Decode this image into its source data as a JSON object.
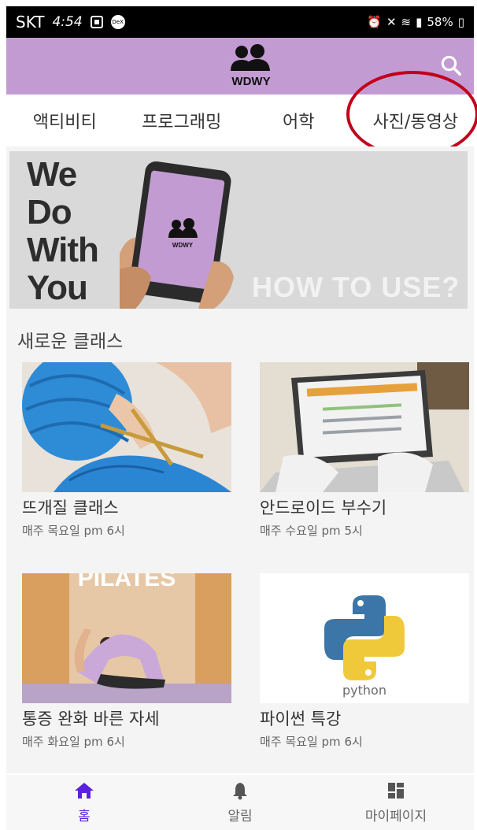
{
  "status_bar": {
    "carrier": "SKT",
    "time": "4:54",
    "battery": "58%"
  },
  "app": {
    "logo_text": "WDWY",
    "brand_color": "#c39bd3",
    "search_icon": "search-icon"
  },
  "tabs": [
    {
      "label": "액티비티"
    },
    {
      "label": "프로그래밍"
    },
    {
      "label": "어학"
    },
    {
      "label": "사진/동영상"
    }
  ],
  "banner": {
    "line1": "We",
    "line2": "Do",
    "line3": "With",
    "line4": "You",
    "phone_logo": "WDWY",
    "cta": "HOW TO USE?"
  },
  "section": {
    "title": "새로운 클래스"
  },
  "classes": [
    {
      "title": "뜨개질 클래스",
      "schedule": "매주 목요일 pm 6시"
    },
    {
      "title": "안드로이드 부수기",
      "schedule": "매주 수요일 pm 5시"
    },
    {
      "title": "통증 완화 바른 자세",
      "schedule": "매주 화요일 pm 6시",
      "image_text": "PILATES"
    },
    {
      "title": "파이썬 특강",
      "schedule": "매주 목요일 pm 6시",
      "image_text": "python"
    }
  ],
  "bottom_nav": [
    {
      "label": "홈",
      "icon": "home-icon",
      "active": true
    },
    {
      "label": "알림",
      "icon": "bell-icon",
      "active": false
    },
    {
      "label": "마이페이지",
      "icon": "dashboard-icon",
      "active": false
    }
  ],
  "colors": {
    "accent": "#5b21e0",
    "highlight_circle": "#c0001a"
  }
}
